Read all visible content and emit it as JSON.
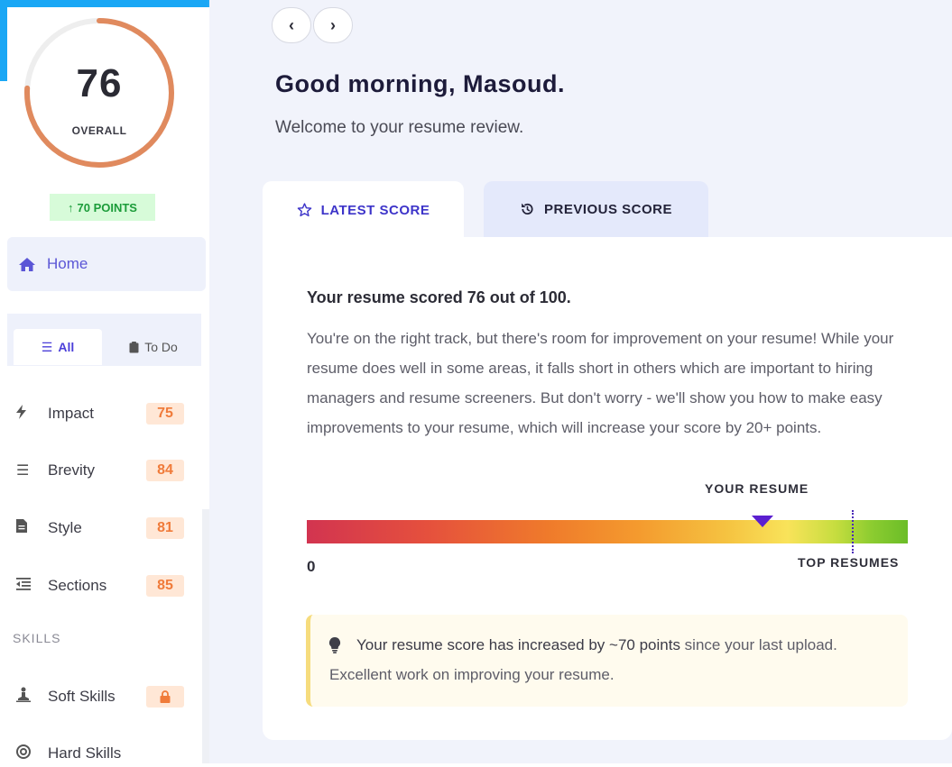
{
  "sidebar": {
    "overall_score": "76",
    "overall_score_value": 76,
    "overall_label": "OVERALL",
    "points_change": "70 POINTS",
    "home_label": "Home",
    "filter_all_label": "All",
    "filter_todo_label": "To Do",
    "categories": [
      {
        "label": "Impact",
        "score": "75",
        "icon": "bolt-icon"
      },
      {
        "label": "Brevity",
        "score": "84",
        "icon": "list-icon"
      },
      {
        "label": "Style",
        "score": "81",
        "icon": "file-icon"
      },
      {
        "label": "Sections",
        "score": "85",
        "icon": "outdent-icon"
      }
    ],
    "skills_heading": "SKILLS",
    "skills": [
      {
        "label": "Soft Skills",
        "locked": true,
        "icon": "person-meditate-icon"
      },
      {
        "label": "Hard Skills",
        "icon": "target-icon"
      }
    ],
    "colors": {
      "ring": "#e08a5e",
      "badge_bg": "#d7fbd9",
      "badge_text": "#1c9c3a",
      "accent": "#1aa7f5"
    }
  },
  "main": {
    "greeting": "Good morning, Masoud.",
    "welcome": "Welcome to your resume review.",
    "tabs": [
      {
        "label": "LATEST SCORE",
        "active": true
      },
      {
        "label": "PREVIOUS SCORE",
        "active": false
      }
    ],
    "card": {
      "heading": "Your resume scored 76 out of 100.",
      "body": "You're on the right track, but there's room for improvement on your resume! While your resume does well in some areas, it falls short in others which are important to hiring managers and resume screeners. But don't worry - we'll show you how to make easy improvements to your resume, which will increase your score by 20+ points.",
      "bar": {
        "your_resume_label": "YOUR RESUME",
        "zero_label": "0",
        "top_resumes_label": "TOP RESUMES"
      },
      "tip": {
        "prefix": "Your resume score has increased by ~70 points",
        "suffix": " since your last upload. Excellent work on improving your resume."
      }
    }
  }
}
